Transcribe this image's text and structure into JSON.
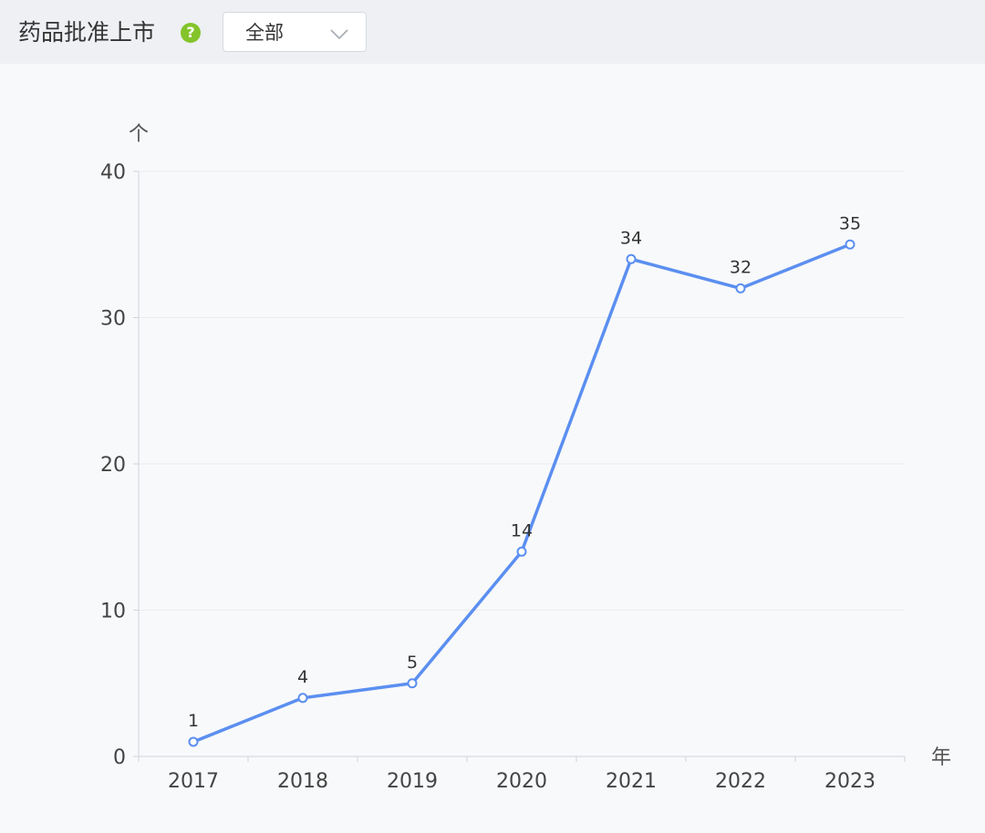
{
  "header": {
    "title": "药品批准上市",
    "help_icon": "question-circle-icon",
    "dropdown": {
      "value": "全部",
      "icon": "chevron-down-icon"
    }
  },
  "colors": {
    "line": "#5b8ff0",
    "help_icon": "#84c42b",
    "header_bg": "#eef0f4",
    "plot_bg": "#f8f9fb"
  },
  "chart_data": {
    "type": "line",
    "categories": [
      "2017",
      "2018",
      "2019",
      "2020",
      "2021",
      "2022",
      "2023"
    ],
    "values": [
      1,
      4,
      5,
      14,
      34,
      32,
      35
    ],
    "data_labels": [
      "1",
      "4",
      "5",
      "14",
      "34",
      "32",
      "35"
    ],
    "ylim": [
      0,
      40
    ],
    "yticks": [
      0,
      10,
      20,
      30,
      40
    ],
    "ytick_labels": [
      "0",
      "10",
      "20",
      "30",
      "40"
    ],
    "xunit": "年",
    "yunit": "个",
    "grid": true,
    "legend": "none"
  }
}
